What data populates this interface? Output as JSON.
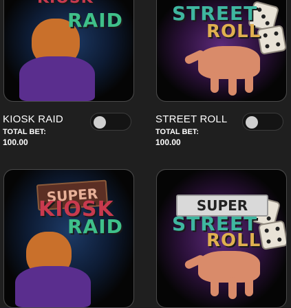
{
  "games": [
    {
      "name": "KIOSK RAID",
      "bet_label": "TOTAL BET:",
      "bet_value": "100.00",
      "art_words": [
        "KIOSK",
        "RAID"
      ]
    },
    {
      "name": "STREET ROLL",
      "bet_label": "TOTAL BET:",
      "bet_value": "100.00",
      "art_words": [
        "STREET",
        "ROLL"
      ]
    },
    {
      "art_sign": "SUPER",
      "art_words": [
        "KIOSK",
        "RAID"
      ]
    },
    {
      "art_sign": "SUPER",
      "art_words": [
        "STREET",
        "ROLL"
      ]
    }
  ],
  "colors": {
    "background": "#1f1f1f",
    "toggle_off_track": "#141414",
    "toggle_knob": "#cfcfcf"
  }
}
